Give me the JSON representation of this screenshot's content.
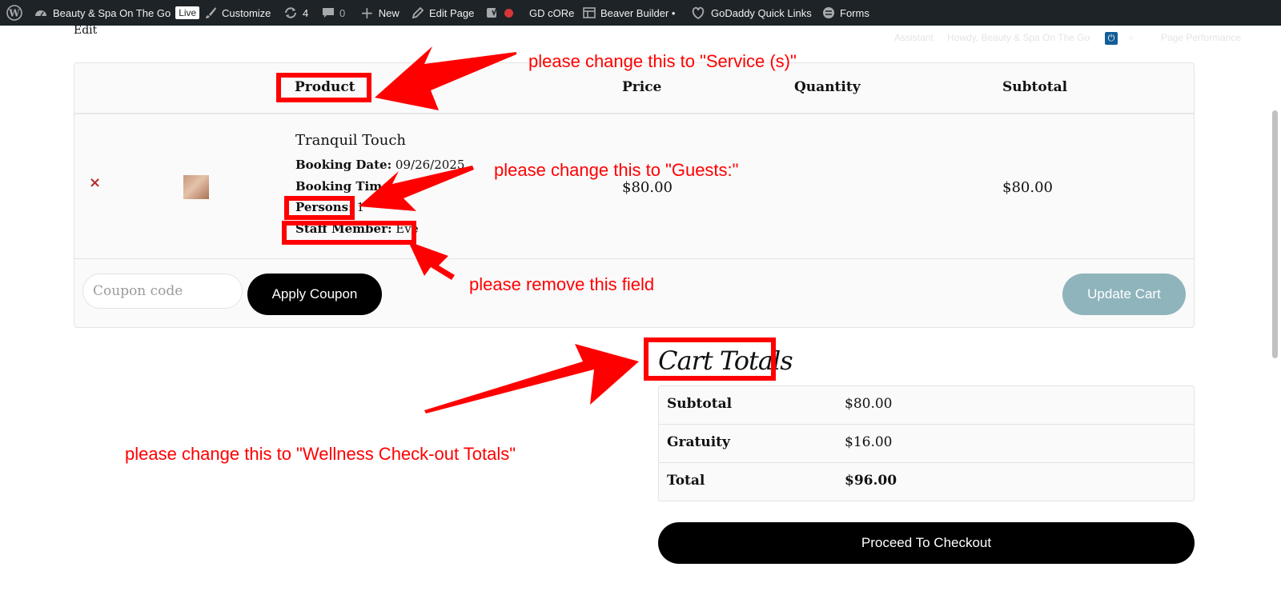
{
  "adminbar": {
    "site_name": "Beauty & Spa On The Go",
    "live_badge": "Live",
    "customize": "Customize",
    "updates_count": "4",
    "comments_count": "0",
    "new": "New",
    "edit_page": "Edit Page",
    "gd_core": "GD cORe",
    "beaver_builder": "Beaver Builder •",
    "godaddy_quick_links": "GoDaddy Quick Links",
    "forms": "Forms"
  },
  "overlay": {
    "assistant": "Assistant",
    "howdy": "Howdy, Beauty & Spa On The Go",
    "page_performance": "Page Performance"
  },
  "edit_link": "Edit",
  "cart": {
    "headers": {
      "product": "Product",
      "price": "Price",
      "quantity": "Quantity",
      "subtotal": "Subtotal"
    },
    "item": {
      "remove": "×",
      "name": "Tranquil Touch",
      "booking_date_label": "Booking Date:",
      "booking_date_value": "09/26/2025",
      "booking_time_label": "Booking Time:",
      "booking_time_value": "",
      "persons_label": "Persons:",
      "persons_value": "1",
      "staff_label": "Staff Member:",
      "staff_value": "Eve",
      "price": "$80.00",
      "subtotal": "$80.00"
    },
    "coupon_placeholder": "Coupon code",
    "apply_coupon": "Apply Coupon",
    "update_cart": "Update Cart"
  },
  "totals": {
    "title": "Cart Totals",
    "rows": [
      {
        "label": "Subtotal",
        "value": "$80.00"
      },
      {
        "label": "Gratuity",
        "value": "$16.00"
      },
      {
        "label": "Total",
        "value": "$96.00"
      }
    ],
    "checkout": "Proceed To Checkout"
  },
  "annotations": {
    "note_service": "please change this to \"Service (s)\"",
    "note_guests": "please change this to \"Guests:\"",
    "note_remove": "please remove this field",
    "note_wellness": "please change this to \"Wellness Check-out Totals\""
  },
  "colors": {
    "annotation_red": "#ff0000",
    "adminbar_bg": "#1d2327",
    "update_cart_bg": "#8fb4bc",
    "remove_x": "#b32d2e"
  },
  "icons": [
    "wordpress-icon",
    "dashboard-icon",
    "brush-icon",
    "updates-icon",
    "comment-icon",
    "plus-icon",
    "pencil-icon",
    "yoast-icon",
    "status-dot-icon",
    "beaver-builder-icon",
    "godaddy-icon",
    "forms-icon",
    "power-icon",
    "search-icon"
  ]
}
